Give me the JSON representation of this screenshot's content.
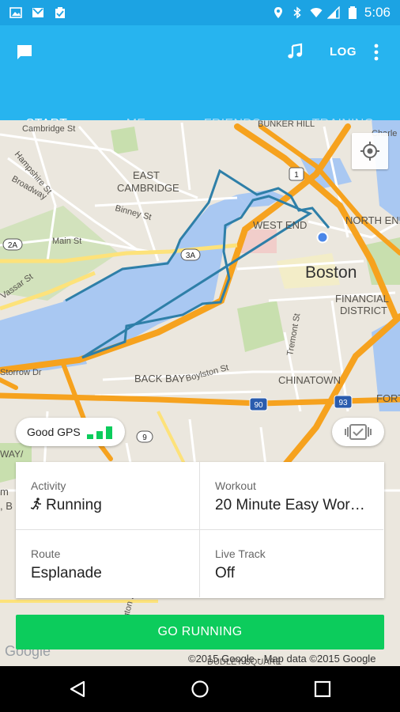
{
  "status_bar": {
    "time": "5:06"
  },
  "app_bar": {
    "log_label": "LOG"
  },
  "tabs": [
    {
      "label": "START"
    },
    {
      "label": "ME"
    },
    {
      "label": "FRIENDS"
    },
    {
      "label": "TRAINING"
    }
  ],
  "map": {
    "labels": {
      "bunker_hill": "BUNKER HILL",
      "charlestown": "Charle",
      "cambridge_st": "Cambridge St",
      "hampshire_st": "Hampshire St",
      "broadway": "Broadway",
      "east_cambridge_1": "EAST",
      "east_cambridge_2": "CAMBRIDGE",
      "binney_st": "Binney St",
      "main_st": "Main St",
      "vassar_st": "Vassar St",
      "west_end": "WEST END",
      "north_end": "NORTH END",
      "boston": "Boston",
      "financial_1": "FINANCIAL",
      "financial_2": "DISTRICT",
      "storrow": "Storrow Dr",
      "tremont": "Tremont St",
      "back_bay": "BACK BAY",
      "boylston": "Boylston St",
      "chinatown": "CHINATOWN",
      "fort": "FORT",
      "way": "WAY/",
      "edge_m": "m",
      "edge_b": ", B",
      "wash_st": "ington St",
      "dudley": "DUDLEY SQUARE",
      "google": "Google",
      "copyright": "©2015 Google - Map data ©2015 Google"
    },
    "shields": {
      "r1": "1",
      "r2a": "2A",
      "r3a": "3A",
      "r9": "9",
      "r90": "90",
      "r93": "93"
    }
  },
  "gps": {
    "label": "Good GPS",
    "signal_bars_lit": 3
  },
  "summary": {
    "activity_label": "Activity",
    "activity_value": "Running",
    "workout_label": "Workout",
    "workout_value": "20 Minute Easy Wor…",
    "route_label": "Route",
    "route_value": "Esplanade",
    "livetrack_label": "Live Track",
    "livetrack_value": "Off"
  },
  "go_button": {
    "label": "GO RUNNING"
  },
  "colors": {
    "status_bar": "#1ca3e3",
    "app_bar": "#27b4ef",
    "go_button": "#0ccc5c",
    "route_line": "#2e7fa8",
    "highway": "#f6a21e"
  }
}
